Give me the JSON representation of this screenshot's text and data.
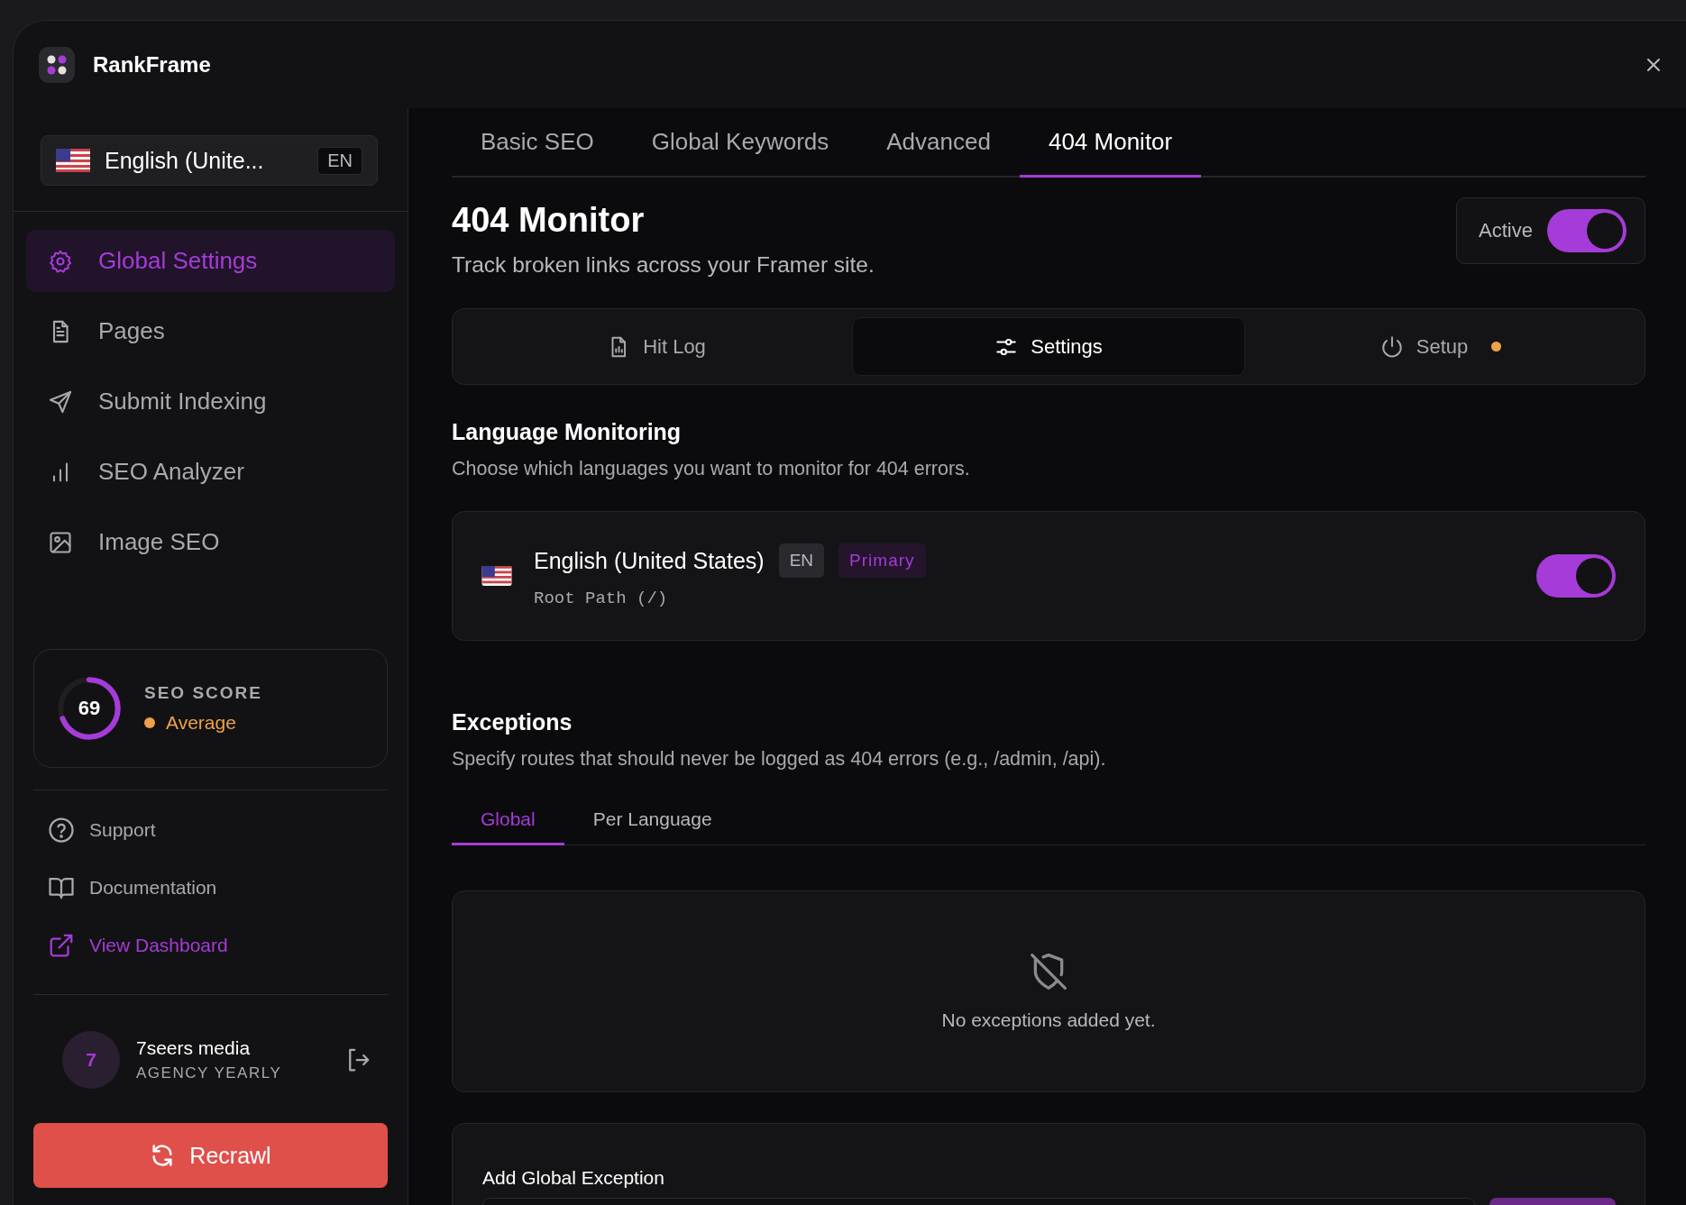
{
  "app": {
    "name": "RankFrame"
  },
  "language_selector": {
    "label": "English (Unite...",
    "code": "EN"
  },
  "nav": [
    {
      "label": "Global Settings",
      "kind": "gear",
      "selected": true
    },
    {
      "label": "Pages",
      "kind": "document",
      "selected": false
    },
    {
      "label": "Submit Indexing",
      "kind": "send",
      "selected": false
    },
    {
      "label": "SEO Analyzer",
      "kind": "bars",
      "selected": false
    },
    {
      "label": "Image SEO",
      "kind": "image",
      "selected": false
    }
  ],
  "seo_score": {
    "label": "SEO SCORE",
    "value": "69",
    "level": 0.69,
    "rating": "Average",
    "color": "#f0a04b"
  },
  "links": [
    {
      "label": "Support",
      "kind": "help"
    },
    {
      "label": "Documentation",
      "kind": "book"
    },
    {
      "label": "View Dashboard",
      "kind": "external"
    }
  ],
  "user": {
    "initial": "7",
    "name": "7seers media",
    "plan": "AGENCY YEARLY"
  },
  "recrawl_button": {
    "label": "Recrawl"
  },
  "tabs": [
    {
      "label": "Basic SEO",
      "selected": false
    },
    {
      "label": "Global Keywords",
      "selected": false
    },
    {
      "label": "Advanced",
      "selected": false
    },
    {
      "label": "404 Monitor",
      "selected": true
    }
  ],
  "page": {
    "title": "404 Monitor",
    "subtitle": "Track broken links across your Framer site.",
    "active_toggle": {
      "label": "Active",
      "on": true
    }
  },
  "sections": [
    {
      "label": "Hit Log",
      "kind": "log",
      "selected": false,
      "indicator": false
    },
    {
      "label": "Settings",
      "kind": "settings",
      "selected": true,
      "indicator": false
    },
    {
      "label": "Setup",
      "kind": "setup",
      "selected": false,
      "indicator": true
    }
  ],
  "language_monitoring": {
    "title": "Language Monitoring",
    "description": "Choose which languages you want to monitor for 404 errors.",
    "languages": [
      {
        "name": "English (United States)",
        "code": "EN",
        "badge": "Primary",
        "path": "Root Path (/)",
        "on": true
      }
    ]
  },
  "exceptions": {
    "title": "Exceptions",
    "description": "Specify routes that should never be logged as 404 errors (e.g., /admin, /api).",
    "tabs": [
      {
        "label": "Global",
        "selected": true
      },
      {
        "label": "Per Language",
        "selected": false
      }
    ],
    "empty_message": "No exceptions added yet.",
    "add_title": "Add Global Exception"
  }
}
